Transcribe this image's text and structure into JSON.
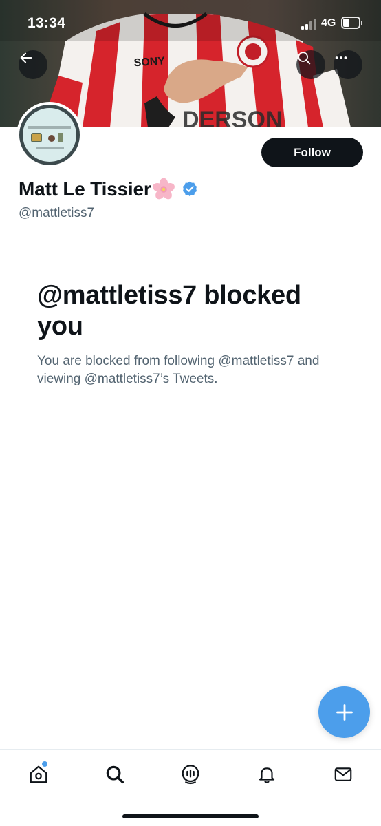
{
  "status_bar": {
    "time": "13:34",
    "network": "4G",
    "battery_level": 0.4
  },
  "header": {
    "back_icon": "arrow-left-icon",
    "search_icon": "search-icon",
    "more_icon": "more-horizontal-icon"
  },
  "profile": {
    "display_name": "Matt Le Tissier",
    "name_emoji": "cherry-blossom-icon",
    "verified_icon": "verified-badge-icon",
    "username": "@mattletiss7",
    "follow_label": "Follow"
  },
  "blocked_notice": {
    "title": "@mattletiss7 blocked you",
    "description": "You are blocked from following @mattletiss7 and viewing @mattletiss7’s Tweets."
  },
  "fab": {
    "icon": "plus-icon"
  },
  "bottom_nav": {
    "items": [
      {
        "name": "home",
        "icon": "home-icon",
        "has_notification_dot": true
      },
      {
        "name": "search",
        "icon": "search-icon"
      },
      {
        "name": "spaces",
        "icon": "spaces-icon"
      },
      {
        "name": "notifications",
        "icon": "bell-icon"
      },
      {
        "name": "messages",
        "icon": "mail-icon"
      }
    ]
  },
  "colors": {
    "accent": "#4c9eeb",
    "text_primary": "#0f1419",
    "text_secondary": "#536471",
    "jersey_red": "#d6242c"
  }
}
